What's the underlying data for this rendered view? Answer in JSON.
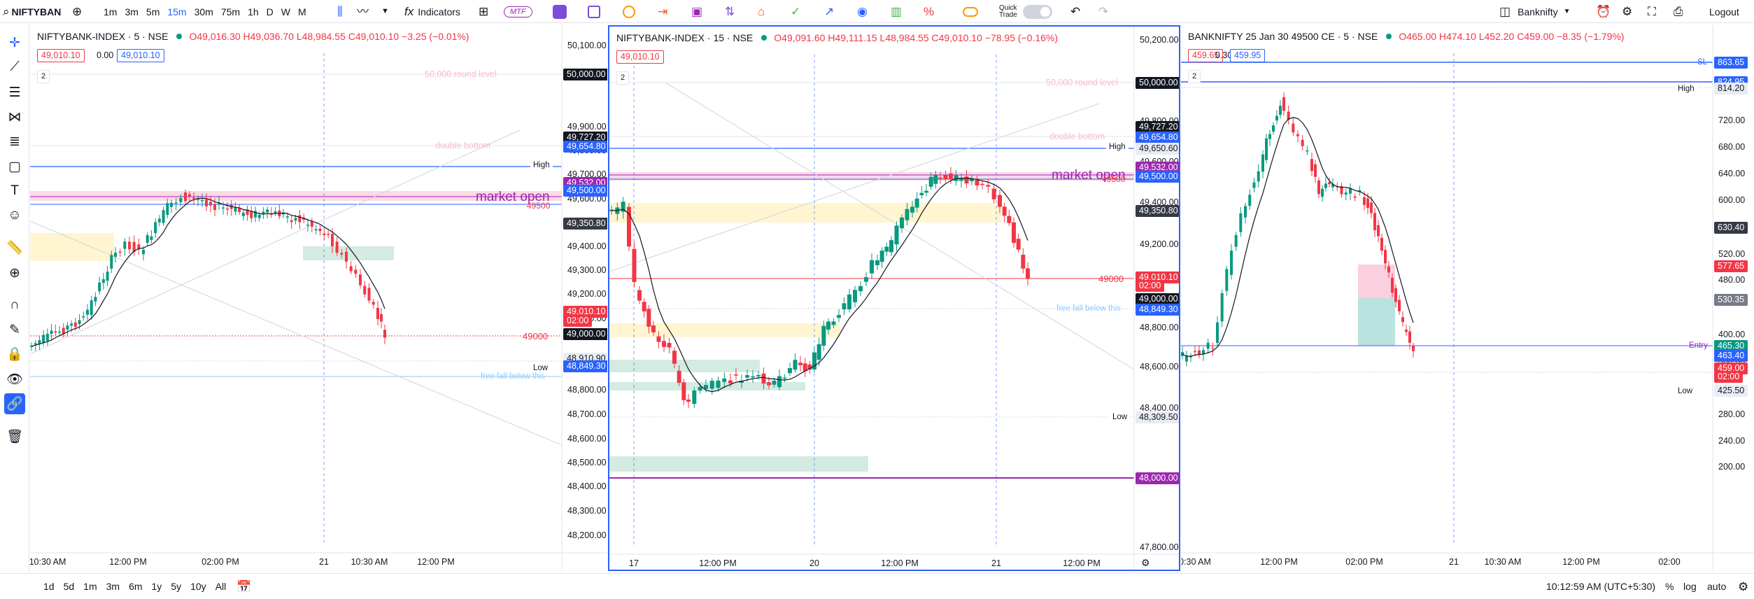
{
  "toolbar": {
    "symbol": "NIFTYBAN",
    "intervals": [
      "1m",
      "3m",
      "5m",
      "15m",
      "30m",
      "75m",
      "1h",
      "D",
      "W",
      "M"
    ],
    "active_interval": "15m",
    "indicators": "Indicators",
    "mtf": "MTF",
    "quick_trade": [
      "Quick",
      "Trade"
    ],
    "watchlist": "Banknifty",
    "logout": "Logout"
  },
  "bottom": {
    "ranges": [
      "1d",
      "5d",
      "1m",
      "3m",
      "6m",
      "1y",
      "5y",
      "10y",
      "All"
    ],
    "clock": "10:12:59 AM (UTC+5:30)",
    "pct": "%",
    "log": "log",
    "auto": "auto"
  },
  "panes": [
    {
      "title": "NIFTYBANK-INDEX · 5 · NSE",
      "ohlc": "O49,016.30 H49,036.70 L48,984.55 C49,010.10 −3.25 (−0.01%)",
      "price_box1": "49,010.10",
      "mid_val": "0.00",
      "price_box2": "49,010.10",
      "count": "2",
      "price_axis": [
        "50,100.00",
        "49,900.00",
        "49,800.00",
        "49,700.00",
        "49,600.00",
        "49,500.00",
        "49,400.00",
        "49,300.00",
        "49,200.00",
        "49,100.00",
        "48,900.00",
        "48,800.00",
        "48,700.00",
        "48,600.00",
        "48,500.00",
        "48,400.00",
        "48,300.00",
        "48,200.00"
      ],
      "time_axis": [
        "10:30 AM",
        "12:00 PM",
        "02:00 PM",
        "21",
        "10:30 AM",
        "12:00 PM"
      ],
      "tags": [
        {
          "text": "50,000.00",
          "bg": "#131722",
          "fg": "#ffffff"
        },
        {
          "text": "49,727.20",
          "bg": "#131722",
          "fg": "#ffffff"
        },
        {
          "text": "49,654.80",
          "bg": "#2962ff",
          "fg": "#ffffff"
        },
        {
          "text": "49,532.00",
          "bg": "#9c27b0",
          "fg": "#ffffff"
        },
        {
          "text": "49,500.00",
          "bg": "#2962ff",
          "fg": "#ffffff"
        },
        {
          "text": "49,350.80",
          "bg": "#363a45",
          "fg": "#ffffff"
        },
        {
          "text": "49,010.10",
          "bg": "#f23645",
          "fg": "#ffffff"
        },
        {
          "text": "02:00",
          "bg": "#f23645",
          "fg": "#ffffff"
        },
        {
          "text": "49,000.00",
          "bg": "#131722",
          "fg": "#ffffff"
        },
        {
          "text": "48,910.90",
          "bg": "#e9ecf2",
          "fg": "#131722"
        },
        {
          "text": "48,849.30",
          "bg": "#2962ff",
          "fg": "#ffffff"
        }
      ],
      "labels": {
        "round": "50,000 round level",
        "double_bottom": "double bottom",
        "high": "High",
        "market_open": "market open",
        "l49500": "49500",
        "l49000": "49000",
        "low": "Low",
        "free_fall": "free fall below this"
      }
    },
    {
      "title": "NIFTYBANK-INDEX · 15 · NSE",
      "ohlc": "O49,091.60 H49,111.15 L48,984.55 C49,010.10 −78.95 (−0.16%)",
      "price_box1": "49,010.10",
      "count": "2",
      "price_axis": [
        "50,200.00",
        "49,800.00",
        "49,600.00",
        "49,400.00",
        "49,200.00",
        "48,800.00",
        "48,600.00",
        "48,400.00",
        "47,800.00"
      ],
      "time_axis": [
        "17",
        "12:00 PM",
        "20",
        "12:00 PM",
        "21",
        "12:00 PM"
      ],
      "tags": [
        {
          "text": "50,000.00",
          "bg": "#131722",
          "fg": "#ffffff"
        },
        {
          "text": "49,727.20",
          "bg": "#131722",
          "fg": "#ffffff"
        },
        {
          "text": "49,654.80",
          "bg": "#2962ff",
          "fg": "#ffffff"
        },
        {
          "text": "49,650.60",
          "bg": "#e9ecf2",
          "fg": "#131722"
        },
        {
          "text": "49,532.00",
          "bg": "#9c27b0",
          "fg": "#ffffff"
        },
        {
          "text": "49,500.00",
          "bg": "#2962ff",
          "fg": "#ffffff"
        },
        {
          "text": "49,350.80",
          "bg": "#363a45",
          "fg": "#ffffff"
        },
        {
          "text": "49,010.10",
          "bg": "#f23645",
          "fg": "#ffffff"
        },
        {
          "text": "02:00",
          "bg": "#f23645",
          "fg": "#ffffff"
        },
        {
          "text": "49,000.00",
          "bg": "#131722",
          "fg": "#ffffff"
        },
        {
          "text": "48,849.30",
          "bg": "#2962ff",
          "fg": "#ffffff"
        },
        {
          "text": "48,309.50",
          "bg": "#e9ecf2",
          "fg": "#131722"
        },
        {
          "text": "48,000.00",
          "bg": "#9c27b0",
          "fg": "#ffffff"
        }
      ],
      "labels": {
        "round": "50,000 round level",
        "double_bottom": "double bottom",
        "high": "High",
        "market_open": "market open",
        "l49500": "49500",
        "l49000": "49000",
        "low": "Low",
        "free_fall": "free fall below this"
      }
    },
    {
      "title": "BANKNIFTY 25 Jan 30 49500 CE · 5 · NSE",
      "ohlc": "O465.00 H474.10 L452.20 C459.00 −8.35 (−1.79%)",
      "price_box1": "459.65",
      "mid_val": "0.30",
      "price_box2": "459.95",
      "count": "2",
      "price_axis": [
        "800.00",
        "760.00",
        "720.00",
        "680.00",
        "640.00",
        "600.00",
        "560.00",
        "520.00",
        "480.00",
        "400.00",
        "360.00",
        "320.00",
        "280.00",
        "240.00",
        "200.00"
      ],
      "time_axis": [
        "0:30 AM",
        "12:00 PM",
        "02:00 PM",
        "21",
        "10:30 AM",
        "12:00 PM",
        "02:00"
      ],
      "tags": [
        {
          "text": "863.65",
          "bg": "#2962ff",
          "fg": "#ffffff"
        },
        {
          "text": "824.95",
          "bg": "#2962ff",
          "fg": "#ffffff"
        },
        {
          "text": "814.20",
          "bg": "#e9ecf2",
          "fg": "#131722"
        },
        {
          "text": "630.40",
          "bg": "#363a45",
          "fg": "#ffffff"
        },
        {
          "text": "577.65",
          "bg": "#f23645",
          "fg": "#ffffff"
        },
        {
          "text": "530.35",
          "bg": "#787b86",
          "fg": "#ffffff"
        },
        {
          "text": "465.30",
          "bg": "#089981",
          "fg": "#ffffff"
        },
        {
          "text": "463.40",
          "bg": "#2962ff",
          "fg": "#ffffff"
        },
        {
          "text": "459.00",
          "bg": "#f23645",
          "fg": "#ffffff"
        },
        {
          "text": "02:00",
          "bg": "#f23645",
          "fg": "#ffffff"
        },
        {
          "text": "425.50",
          "bg": "#e9ecf2",
          "fg": "#131722"
        }
      ],
      "labels": {
        "sl": "SL",
        "high": "High",
        "entry": "Entry",
        "low": "Low"
      }
    }
  ],
  "colors": {
    "up": "#089981",
    "down": "#f23645",
    "accent": "#2962ff",
    "purple": "#9c27b0"
  }
}
